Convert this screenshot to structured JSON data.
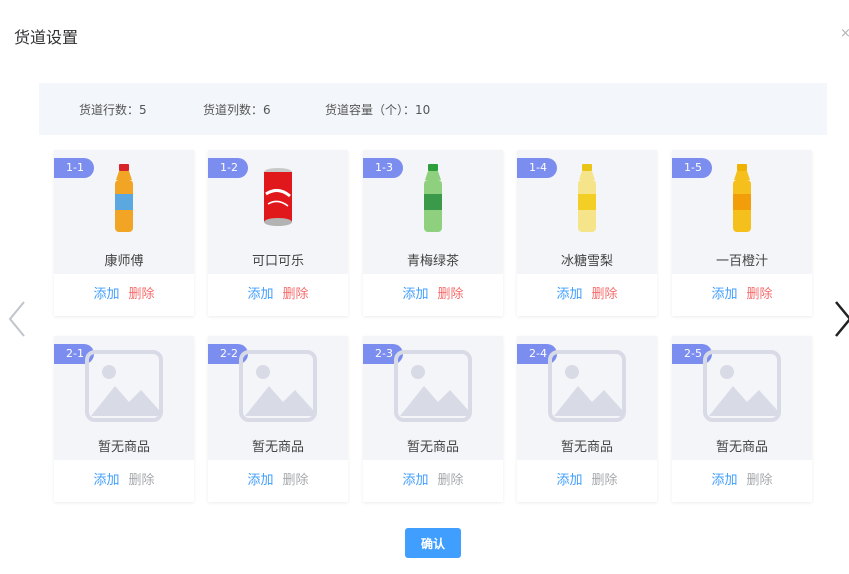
{
  "dialog": {
    "title": "货道设置"
  },
  "info": {
    "rows": "货道行数：5",
    "cols": "货道列数：6",
    "capacity": "货道容量（个）：10"
  },
  "slots": [
    {
      "id": "1-1",
      "name": "康师傅",
      "add": "添加",
      "delete": "删除",
      "product": "bottle-icon",
      "cap": "#d7242a",
      "body": "#f2a524",
      "label": "#5ba7e0"
    },
    {
      "id": "1-2",
      "name": "可口可乐",
      "add": "添加",
      "delete": "删除",
      "product": "can-icon",
      "cap": "#c9c9c9",
      "body": "#e0181b",
      "label": "#ffffff"
    },
    {
      "id": "1-3",
      "name": "青梅绿茶",
      "add": "添加",
      "delete": "删除",
      "product": "bottle-icon",
      "cap": "#2e9e3d",
      "body": "#8fd07f",
      "label": "#3a9a4a"
    },
    {
      "id": "1-4",
      "name": "冰糖雪梨",
      "add": "添加",
      "delete": "删除",
      "product": "bottle-icon",
      "cap": "#e8c516",
      "body": "#f5e48a",
      "label": "#f3cf25"
    },
    {
      "id": "1-5",
      "name": "一百橙汁",
      "add": "添加",
      "delete": "删除",
      "product": "bottle-icon",
      "cap": "#f0b200",
      "body": "#f6c01c",
      "label": "#f29d0a"
    },
    {
      "id": "2-1",
      "name": "暂无商品",
      "add": "添加",
      "delete": "删除",
      "product": "image-placeholder-icon"
    },
    {
      "id": "2-2",
      "name": "暂无商品",
      "add": "添加",
      "delete": "删除",
      "product": "image-placeholder-icon"
    },
    {
      "id": "2-3",
      "name": "暂无商品",
      "add": "添加",
      "delete": "删除",
      "product": "image-placeholder-icon"
    },
    {
      "id": "2-4",
      "name": "暂无商品",
      "add": "添加",
      "delete": "删除",
      "product": "image-placeholder-icon"
    },
    {
      "id": "2-5",
      "name": "暂无商品",
      "add": "添加",
      "delete": "删除",
      "product": "image-placeholder-icon"
    }
  ],
  "footer": {
    "confirm": "确认"
  },
  "colors": {
    "accent": "#409eff",
    "danger": "#f56c6c",
    "badge": "#7b8dee"
  }
}
